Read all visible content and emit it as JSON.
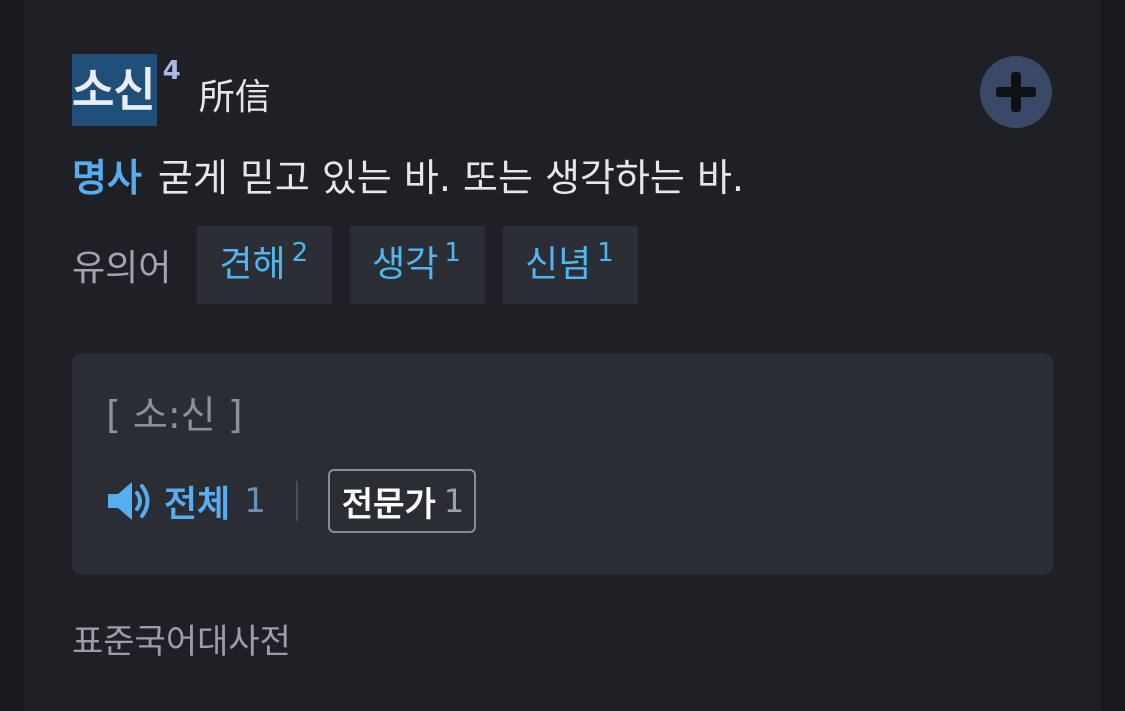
{
  "entry": {
    "headword": "소신",
    "homograph": "4",
    "hanja": "所信",
    "part_of_speech": "명사",
    "definition": "굳게 믿고 있는 바. 또는 생각하는 바."
  },
  "synonyms": {
    "label": "유의어",
    "items": [
      {
        "word": "견해",
        "num": "2"
      },
      {
        "word": "생각",
        "num": "1"
      },
      {
        "word": "신념",
        "num": "1"
      }
    ]
  },
  "pronunciation": {
    "text": "[ 소:신 ]",
    "all_label": "전체",
    "all_count": "1",
    "expert_label": "전문가",
    "expert_count": "1"
  },
  "source": "표준국어대사전",
  "icons": {
    "add": "plus-icon",
    "audio": "speaker-icon"
  },
  "colors": {
    "accent_blue": "#56aef0",
    "headword_highlight": "#1f4e79",
    "card_bg": "#1e2025"
  }
}
